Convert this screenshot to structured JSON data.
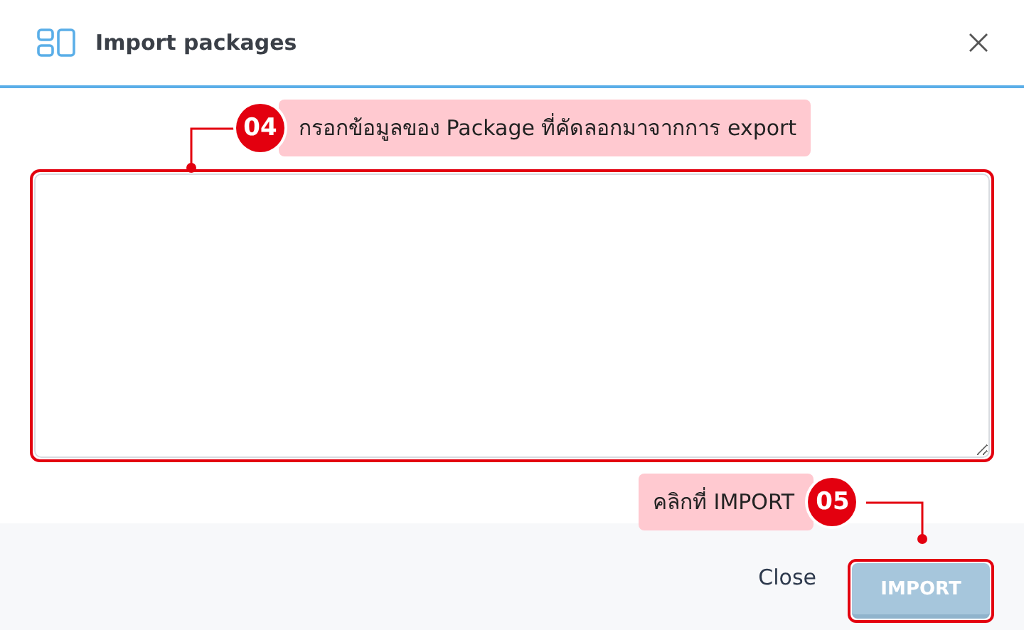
{
  "window": {
    "title": "Import packages"
  },
  "textarea": {
    "highlighted": true
  },
  "annotations": [
    {
      "kind": "number-left",
      "number": "04",
      "text": "กรอกข้อมูลของ Package ที่คัดลอกมาจากการ export"
    },
    {
      "kind": "number-right",
      "number": "05",
      "text": "คลิกที่ IMPORT"
    }
  ],
  "buttons": [
    {
      "kind": "text",
      "label": "Close"
    },
    {
      "kind": "primary",
      "label": "IMPORT",
      "disabled": true,
      "highlighted": true
    }
  ]
}
